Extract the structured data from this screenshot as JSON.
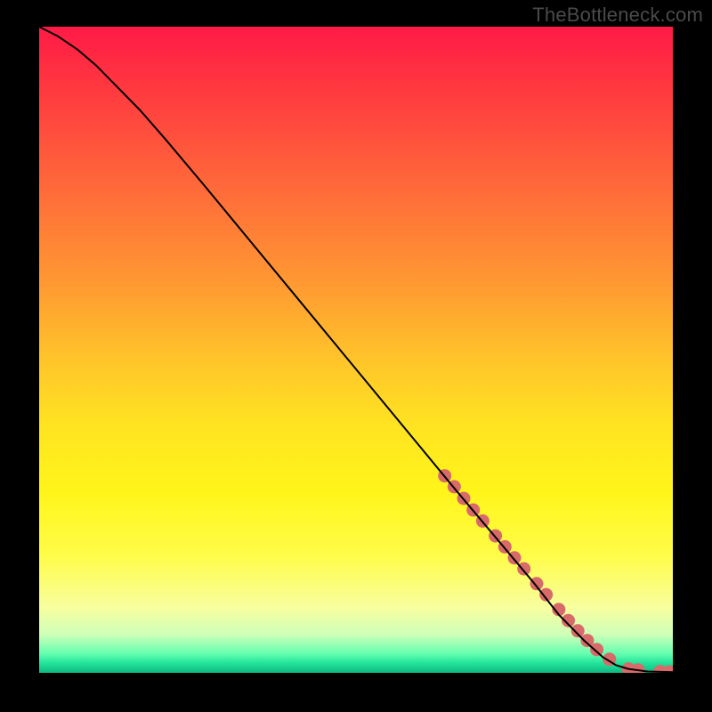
{
  "watermark": "TheBottleneck.com",
  "chart_data": {
    "type": "line",
    "title": "",
    "xlabel": "",
    "ylabel": "",
    "xlim": [
      0,
      100
    ],
    "ylim": [
      0,
      100
    ],
    "grid": false,
    "legend": false,
    "series": [
      {
        "name": "curve",
        "color": "#000000",
        "x": [
          0,
          3,
          6,
          9,
          12,
          16,
          20,
          26,
          34,
          42,
          50,
          58,
          66,
          72,
          78,
          82,
          86,
          89,
          91,
          93,
          96,
          100
        ],
        "y": [
          100,
          98.5,
          96.5,
          94,
          91,
          87,
          82.5,
          75.5,
          66,
          56.5,
          47,
          37.5,
          28,
          21,
          14,
          9,
          5,
          2.4,
          1.2,
          0.6,
          0.2,
          0.1
        ]
      }
    ],
    "markers": {
      "name": "highlighted-points",
      "color": "#d86a6a",
      "radius": 7.5,
      "x": [
        64,
        65.5,
        67,
        68.5,
        70,
        72,
        73.5,
        75,
        76.5,
        78.5,
        80,
        82,
        83.5,
        85,
        86.5,
        88,
        90,
        93,
        94.5,
        98,
        99.5
      ],
      "y": [
        30.5,
        28.8,
        27,
        25.2,
        23.5,
        21.2,
        19.5,
        17.8,
        16.1,
        13.8,
        12.1,
        9.8,
        8.1,
        6.5,
        5,
        3.6,
        2.1,
        0.6,
        0.45,
        0.2,
        0.15
      ]
    },
    "gradient_stops": [
      {
        "pct": 0,
        "color": "#ff1a46"
      },
      {
        "pct": 25,
        "color": "#ff6a3a"
      },
      {
        "pct": 52,
        "color": "#ffc62a"
      },
      {
        "pct": 72,
        "color": "#fff51a"
      },
      {
        "pct": 90,
        "color": "#f7ffa0"
      },
      {
        "pct": 97,
        "color": "#66ffb0"
      },
      {
        "pct": 100,
        "color": "#0fb881"
      }
    ]
  }
}
